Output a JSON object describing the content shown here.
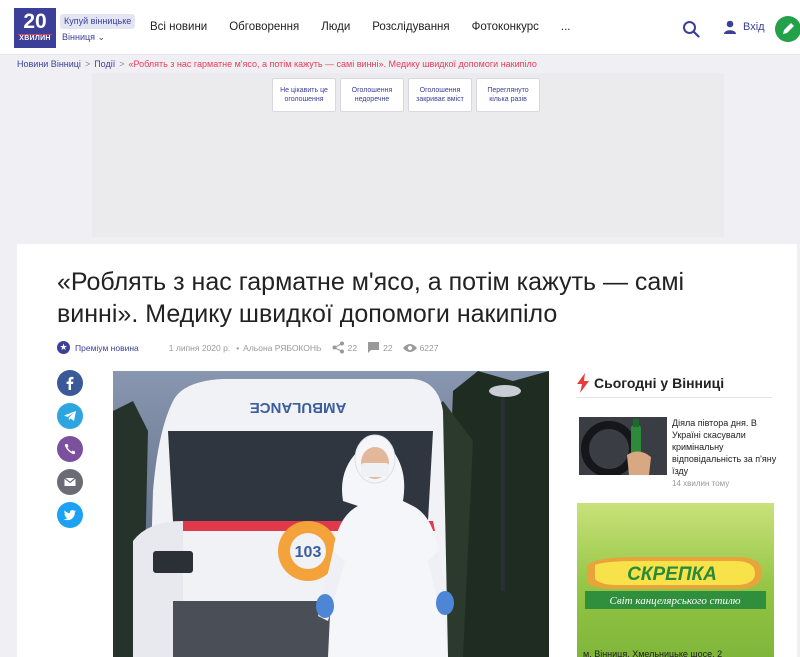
{
  "header": {
    "logo_number": "20",
    "logo_sub": "ХВИЛИН",
    "buy_label": "Купуй вінницьке",
    "city_label": "Вінниця ⌄",
    "nav": [
      "Всі новини",
      "Обговорення",
      "Люди",
      "Розслідування",
      "Фотоконкурс",
      "..."
    ],
    "login_label": "Вхід",
    "icons": [
      "search-icon",
      "user-icon",
      "pencil-icon"
    ]
  },
  "breadcrumb": {
    "items": [
      "Новини Вінниці",
      "Події"
    ],
    "current": "«Роблять з нас гарматне м'ясо, а потім кажуть — самі винні». Медику швидкої допомоги накипіло",
    "separator": ">"
  },
  "ad": {
    "buttons": [
      "Не цікавить це оголошення",
      "Оголошення недоречне",
      "Оголошення закриває вміст",
      "Переглянуто кілька разів"
    ]
  },
  "article": {
    "title": "«Роблять з нас гарматне м'ясо, а потім кажуть — самі винні». Медику швидкої допомоги накипіло",
    "premium_label": "Преміум новина",
    "date": "1 липня 2020 р.",
    "author_sep": "•",
    "author": "Альона РЯБОКОНЬ",
    "shares": "22",
    "comments": "22",
    "views": "6227",
    "ambulance_text": "AMBULANCE",
    "share_icons": [
      "facebook-icon",
      "telegram-icon",
      "viber-icon",
      "email-icon",
      "twitter-icon"
    ]
  },
  "sidebar": {
    "heading": "Сьогодні у Вінниці",
    "news_title": "Дiяла півтора дня. В Україні скасували кримінальну відповідальність за п'яну їзду",
    "news_time": "14 хвилин тому",
    "banner_brand": "СКРЕПКА",
    "banner_tagline": "Світ канцелярського стилю",
    "banner_address": "м. Вінниця, Хмельницьке шосе, 2"
  },
  "colors": {
    "brand": "#3b3f98",
    "accent": "#e83b5a",
    "facebook": "#3b5998",
    "telegram": "#2ca5e0",
    "viber": "#7b519d",
    "email": "#6b6b75",
    "twitter": "#1da1f2"
  }
}
